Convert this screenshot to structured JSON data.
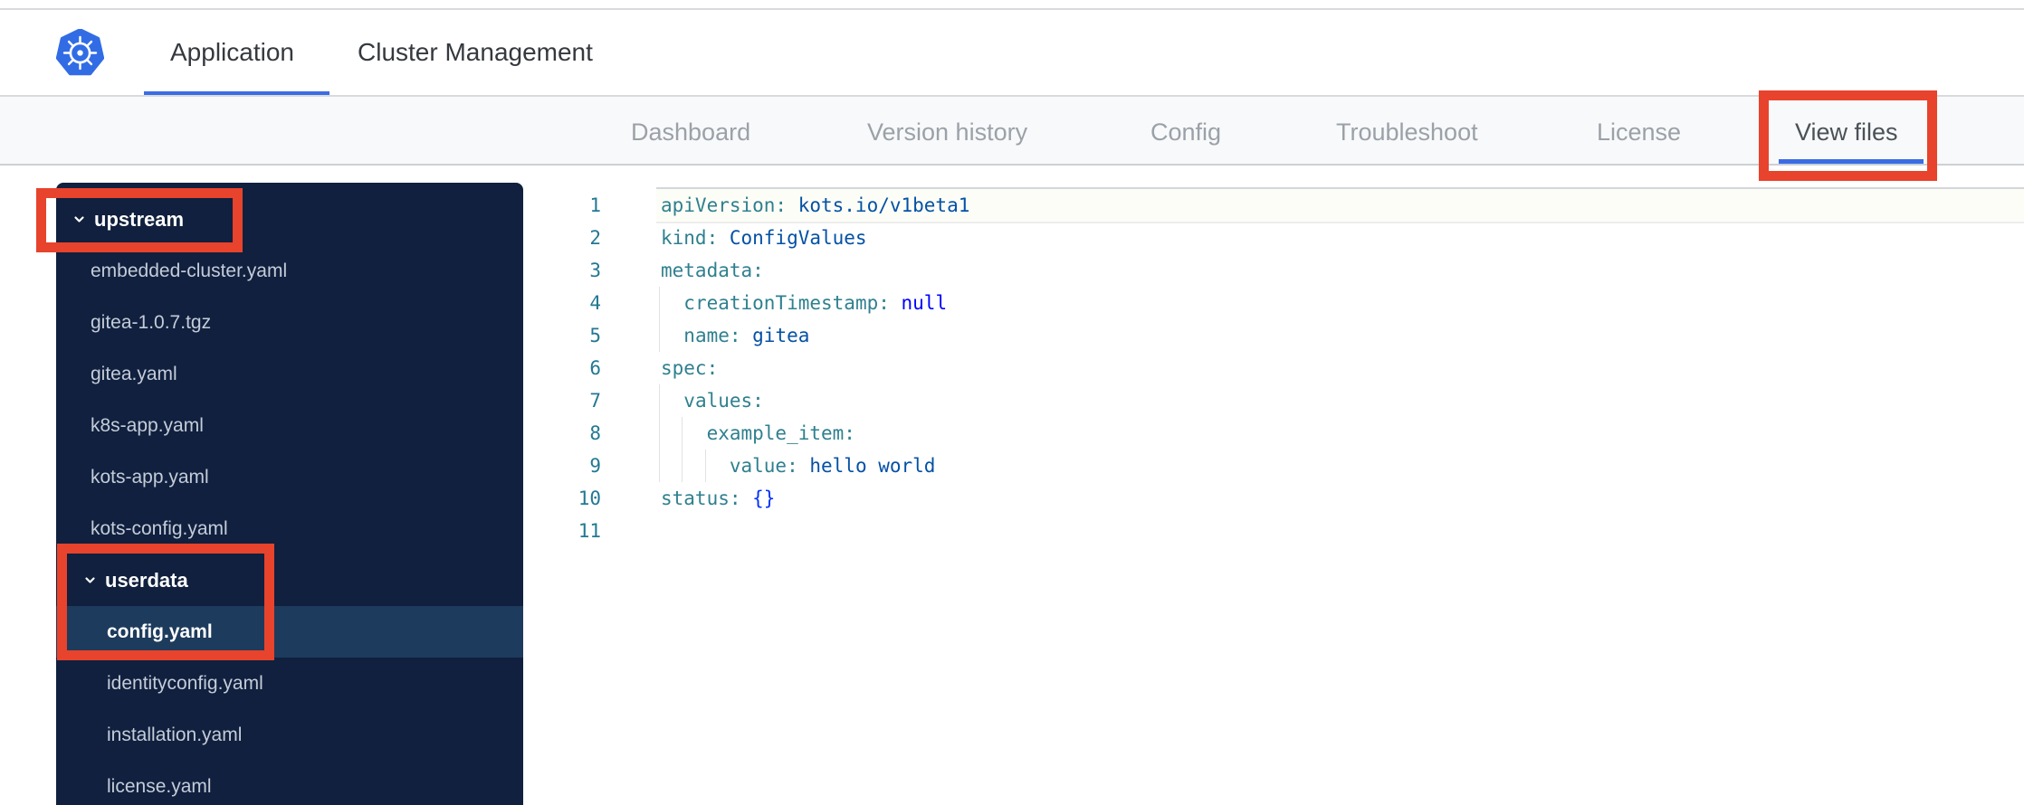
{
  "header": {
    "logo_icon": "kubernetes-logo",
    "tabs": [
      {
        "label": "Application",
        "active": true
      },
      {
        "label": "Cluster Management",
        "active": false
      }
    ]
  },
  "subnav": {
    "items": [
      {
        "label": "Dashboard",
        "active": false
      },
      {
        "label": "Version history",
        "active": false
      },
      {
        "label": "Config",
        "active": false
      },
      {
        "label": "Troubleshoot",
        "active": false
      },
      {
        "label": "License",
        "active": false
      },
      {
        "label": "View files",
        "active": true,
        "annotated": true
      }
    ]
  },
  "sidebar": {
    "items": [
      {
        "label": "upstream",
        "type": "folder",
        "level": 0,
        "expanded": true,
        "annotated": true
      },
      {
        "label": "embedded-cluster.yaml",
        "type": "file",
        "level": 0
      },
      {
        "label": "gitea-1.0.7.tgz",
        "type": "file",
        "level": 0
      },
      {
        "label": "gitea.yaml",
        "type": "file",
        "level": 0
      },
      {
        "label": "k8s-app.yaml",
        "type": "file",
        "level": 0
      },
      {
        "label": "kots-app.yaml",
        "type": "file",
        "level": 0
      },
      {
        "label": "kots-config.yaml",
        "type": "file",
        "level": 0
      },
      {
        "label": "userdata",
        "type": "folder",
        "level": 1,
        "expanded": true,
        "annotated": true
      },
      {
        "label": "config.yaml",
        "type": "file",
        "level": 1,
        "selected": true,
        "annotated": true
      },
      {
        "label": "identityconfig.yaml",
        "type": "file",
        "level": 1
      },
      {
        "label": "installation.yaml",
        "type": "file",
        "level": 1
      },
      {
        "label": "license.yaml",
        "type": "file",
        "level": 1
      }
    ]
  },
  "editor": {
    "file": "config.yaml",
    "lines": [
      {
        "n": 1,
        "indent": 0,
        "current": true,
        "tokens": [
          {
            "text": "apiVersion: ",
            "type": "key"
          },
          {
            "text": "kots.io/v1beta1",
            "type": "str"
          }
        ]
      },
      {
        "n": 2,
        "indent": 0,
        "tokens": [
          {
            "text": "kind: ",
            "type": "key"
          },
          {
            "text": "ConfigValues",
            "type": "str"
          }
        ]
      },
      {
        "n": 3,
        "indent": 0,
        "tokens": [
          {
            "text": "metadata:",
            "type": "key"
          }
        ]
      },
      {
        "n": 4,
        "indent": 2,
        "tokens": [
          {
            "text": "creationTimestamp: ",
            "type": "key"
          },
          {
            "text": "null",
            "type": "kw"
          }
        ]
      },
      {
        "n": 5,
        "indent": 2,
        "tokens": [
          {
            "text": "name: ",
            "type": "key"
          },
          {
            "text": "gitea",
            "type": "str"
          }
        ]
      },
      {
        "n": 6,
        "indent": 0,
        "tokens": [
          {
            "text": "spec:",
            "type": "key"
          }
        ]
      },
      {
        "n": 7,
        "indent": 2,
        "tokens": [
          {
            "text": "values:",
            "type": "key"
          }
        ]
      },
      {
        "n": 8,
        "indent": 4,
        "tokens": [
          {
            "text": "example_item:",
            "type": "key"
          }
        ]
      },
      {
        "n": 9,
        "indent": 6,
        "tokens": [
          {
            "text": "value: ",
            "type": "key"
          },
          {
            "text": "hello world",
            "type": "str"
          }
        ]
      },
      {
        "n": 10,
        "indent": 0,
        "tokens": [
          {
            "text": "status: ",
            "type": "key"
          },
          {
            "text": "{}",
            "type": "br"
          }
        ]
      },
      {
        "n": 11,
        "indent": 0,
        "tokens": []
      }
    ]
  },
  "colors": {
    "annotation": "#E8432C",
    "accent_blue": "#3B6CE4",
    "logo_blue": "#326CE5",
    "header_text": "#35393E",
    "subnav_bg": "#F8F9FA",
    "subnav_text": "#9BA1A8",
    "subnav_active_text": "#4B5157",
    "border_gray": "#D8DADD",
    "sidebar_bg": "#10203E",
    "sidebar_selected_bg": "#1D3B5C",
    "folder_text": "#FFFFFF",
    "file_text": "#C5CCD9",
    "line_number": "#237893",
    "tok_key": "#2F808F",
    "tok_str": "#0451A5",
    "tok_kw": "#0000FF",
    "tok_bracket": "#0431FA"
  }
}
